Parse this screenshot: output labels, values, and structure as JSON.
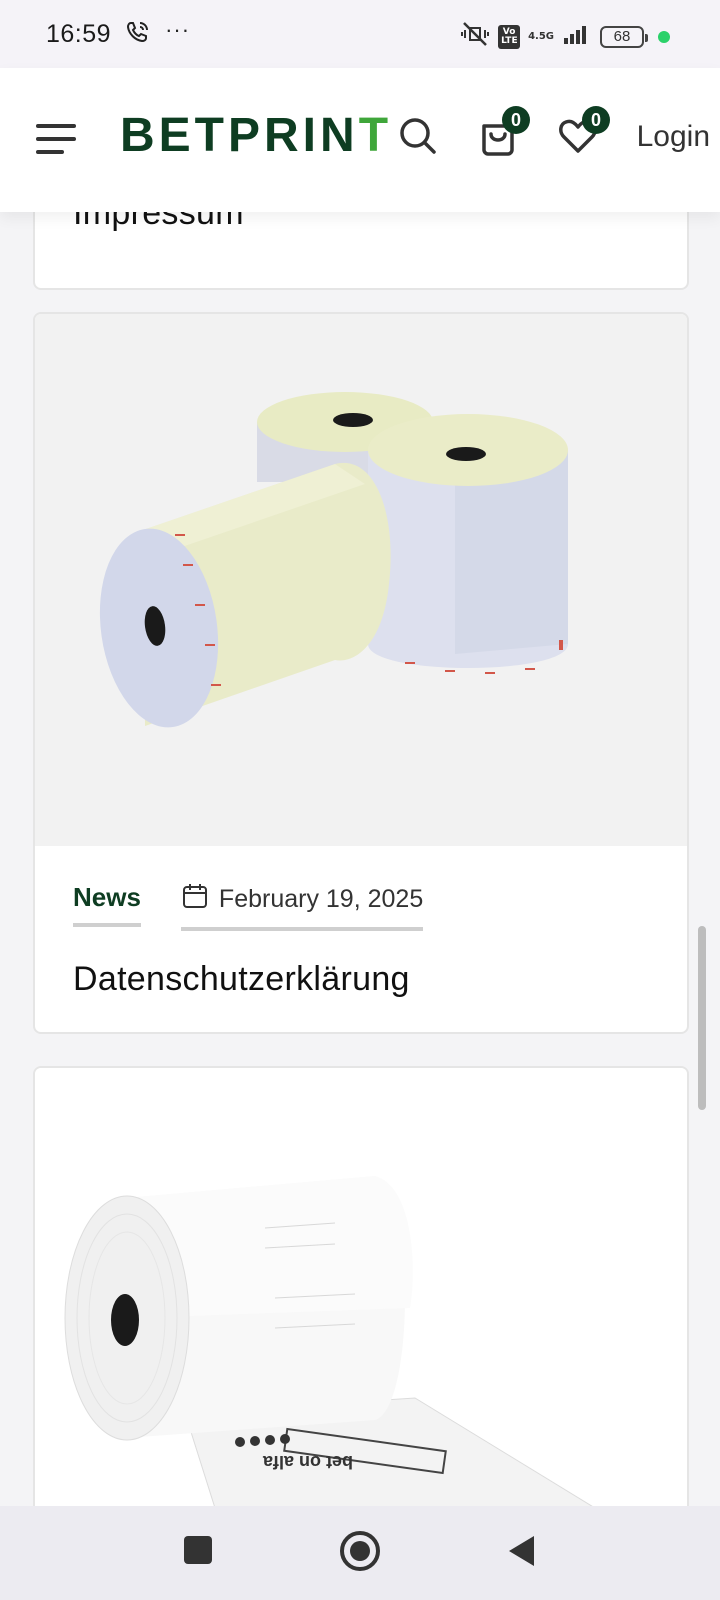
{
  "status_bar": {
    "time": "16:59",
    "more": "···",
    "volte": "Vo LTE",
    "network": "4.5G",
    "battery": "68"
  },
  "header": {
    "logo_main": "BETPRIN",
    "logo_accent": "T",
    "cart_count": "0",
    "wishlist_count": "0",
    "login_label": "Login",
    "brand_dark": "#0e3d22",
    "brand_light": "#3fa63a"
  },
  "posts": [
    {
      "title": "Impressum"
    },
    {
      "image": "thermal-paper-rolls-image",
      "category": "News",
      "date": "February 19, 2025",
      "title": "Datenschutzerklärung"
    },
    {
      "image": "bet-on-alfa-receipt-roll-image"
    }
  ],
  "nav": {
    "recents": "square-icon",
    "home": "circle-icon",
    "back": "triangle-back-icon"
  }
}
